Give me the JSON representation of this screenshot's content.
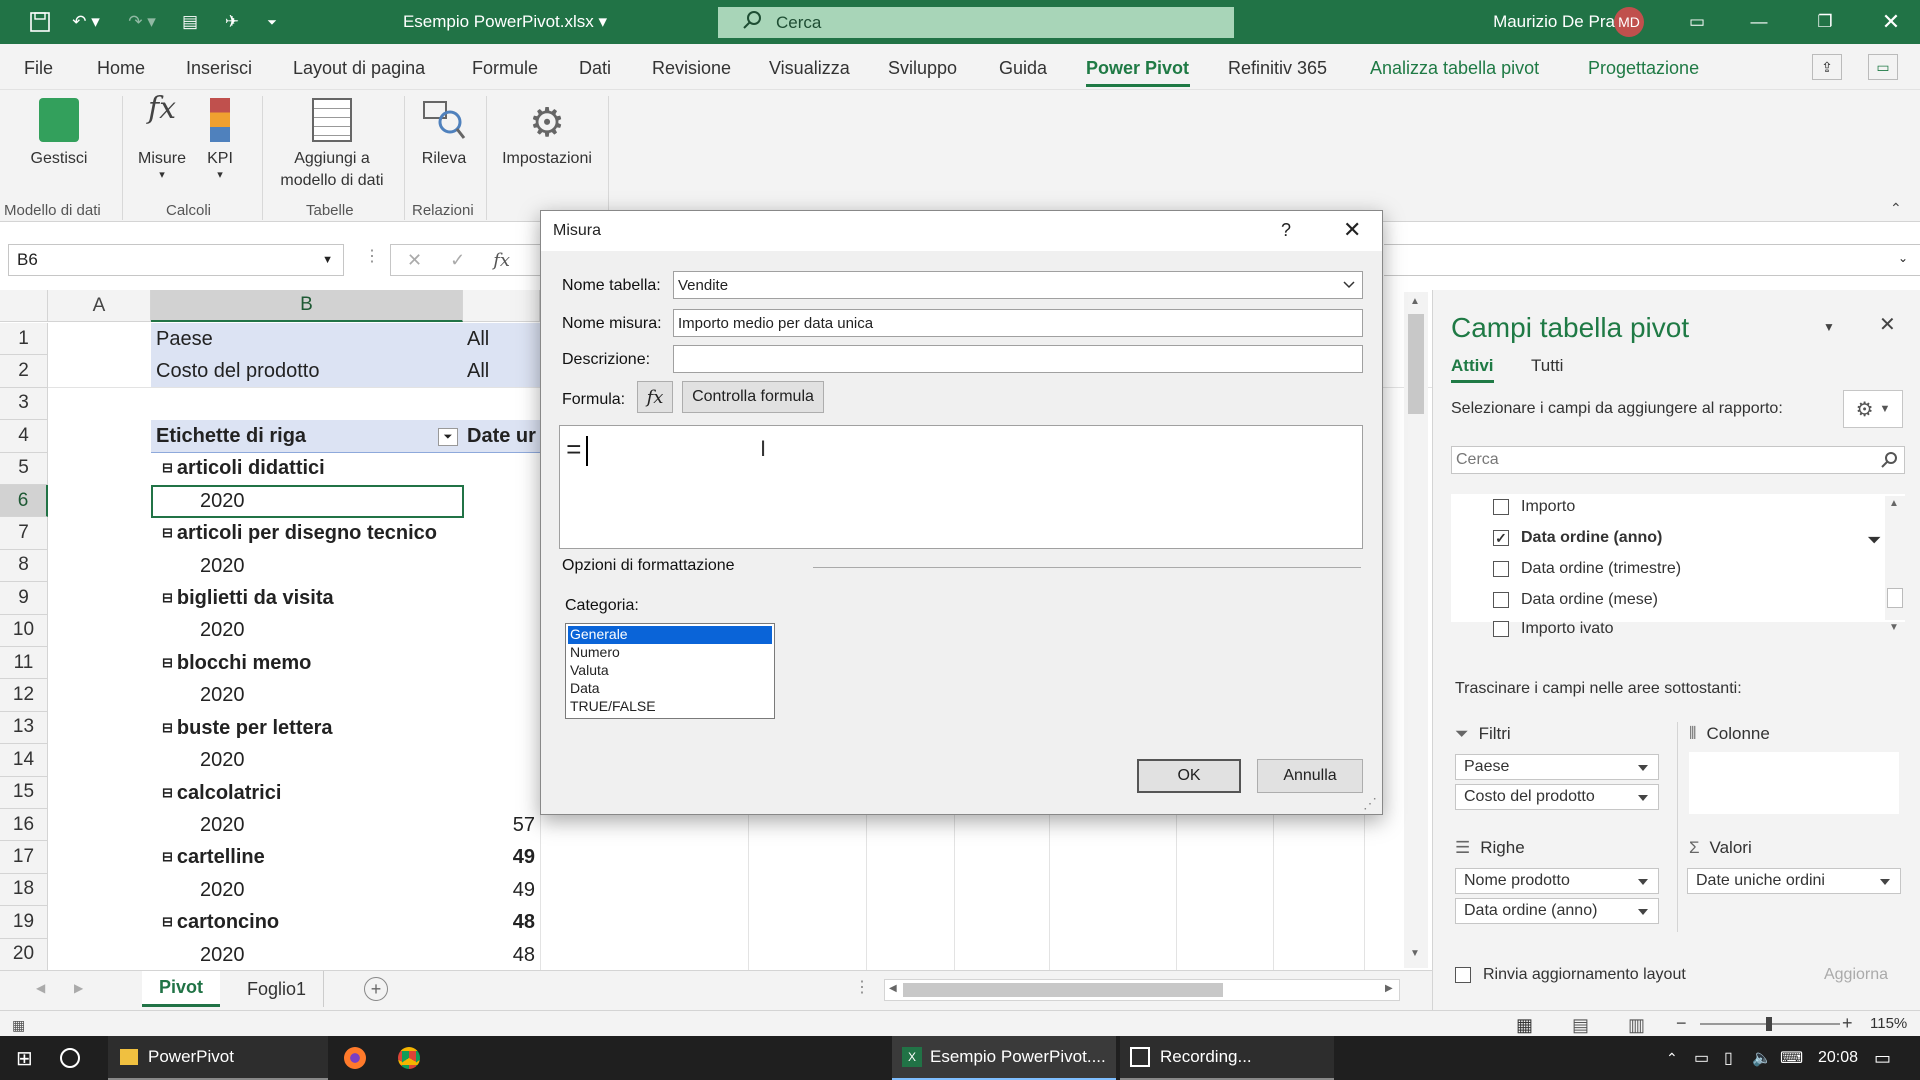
{
  "title_bar": {
    "filename": "Esempio PowerPivot.xlsx",
    "search": "Cerca",
    "user": "Maurizio De Pra",
    "initials": "MD"
  },
  "tabs": [
    "File",
    "Home",
    "Inserisci",
    "Layout di pagina",
    "Formule",
    "Dati",
    "Revisione",
    "Visualizza",
    "Sviluppo",
    "Guida",
    "Power Pivot",
    "Refinitiv 365",
    "Analizza tabella pivot",
    "Progettazione"
  ],
  "ribbon": {
    "gestisci": "Gestisci",
    "misure": "Misure",
    "kpi": "KPI",
    "aggiungi_1": "Aggiungi a",
    "aggiungi_2": "modello di dati",
    "rileva": "Rileva",
    "impostazioni": "Impostazioni",
    "groups": [
      "Modello di dati",
      "Calcoli",
      "Tabelle",
      "Relazioni"
    ]
  },
  "formula_bar": {
    "name_box": "B6"
  },
  "grid": {
    "columns": [
      "A",
      "B"
    ],
    "rows": [
      "1",
      "2",
      "3",
      "4",
      "5",
      "6",
      "7",
      "8",
      "9",
      "10",
      "11",
      "12",
      "13",
      "14",
      "15",
      "16",
      "17",
      "18",
      "19",
      "20"
    ],
    "cells": {
      "b1": "Paese",
      "c1": "All",
      "b2": "Costo del prodotto",
      "c2": "All",
      "b4": "Etichette di riga",
      "c4": "Date ur",
      "b5": "articoli didattici",
      "b6": "2020",
      "b7": "articoli per disegno tecnico",
      "b8": "2020",
      "b9": "biglietti da visita",
      "b10": "2020",
      "b11": "blocchi memo",
      "b12": "2020",
      "b13": "buste per lettera",
      "b14": "2020",
      "b15": "calcolatrici",
      "b16": "2020",
      "c16": "57",
      "b17": "cartelline",
      "c17": "49",
      "b18": "2020",
      "c18": "49",
      "b19": "cartoncino",
      "c19": "48",
      "b20": "2020",
      "c20": "48"
    }
  },
  "dialog": {
    "title": "Misura",
    "help": "?",
    "nome_tabella_label": "Nome tabella:",
    "nome_tabella": "Vendite",
    "nome_misura_label": "Nome misura:",
    "nome_misura": "Importo medio per data unica",
    "descrizione_label": "Descrizione:",
    "descrizione": "",
    "formula_label": "Formula:",
    "fx": "fx",
    "controlla": "Controlla formula",
    "formula": "=",
    "opzioni": "Opzioni di formattazione",
    "categoria_label": "Categoria:",
    "categorie": [
      "Generale",
      "Numero",
      "Valuta",
      "Data",
      "TRUE/FALSE"
    ],
    "ok": "OK",
    "annulla": "Annulla"
  },
  "pivot_pane": {
    "title": "Campi tabella pivot",
    "tab_attivi": "Attivi",
    "tab_tutti": "Tutti",
    "select_label": "Selezionare i campi da aggiungere al rapporto:",
    "search": "Cerca",
    "fields": [
      {
        "label": "Importo",
        "checked": false
      },
      {
        "label": "Data ordine (anno)",
        "checked": true
      },
      {
        "label": "Data ordine (trimestre)",
        "checked": false
      },
      {
        "label": "Data ordine (mese)",
        "checked": false
      },
      {
        "label": "Importo ivato",
        "checked": false
      }
    ],
    "drag_label": "Trascinare i campi nelle aree sottostanti:",
    "filtri": "Filtri",
    "colonne": "Colonne",
    "righe": "Righe",
    "valori": "Valori",
    "filtri_items": [
      "Paese",
      "Costo del prodotto"
    ],
    "righe_items": [
      "Nome prodotto",
      "Data ordine (anno)"
    ],
    "valori_items": [
      "Date uniche ordini"
    ],
    "rinvia": "Rinvia aggiornamento layout",
    "aggiorna": "Aggiorna"
  },
  "sheets": [
    "Pivot",
    "Foglio1"
  ],
  "status": {
    "zoom": "115%"
  },
  "taskbar": {
    "app1": "PowerPivot",
    "app2": "Esempio PowerPivot....",
    "app3": "Recording...",
    "time": "20:08"
  }
}
